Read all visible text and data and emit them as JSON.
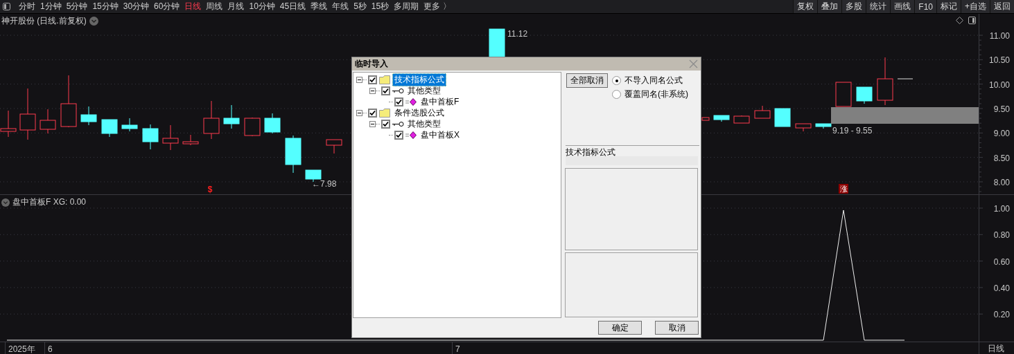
{
  "toolbar": {
    "periods": [
      {
        "label": "分时",
        "selected": false
      },
      {
        "label": "1分钟",
        "selected": false
      },
      {
        "label": "5分钟",
        "selected": false
      },
      {
        "label": "15分钟",
        "selected": false
      },
      {
        "label": "30分钟",
        "selected": false
      },
      {
        "label": "60分钟",
        "selected": false
      },
      {
        "label": "日线",
        "selected": true
      },
      {
        "label": "周线",
        "selected": false
      },
      {
        "label": "月线",
        "selected": false
      },
      {
        "label": "10分钟",
        "selected": false
      },
      {
        "label": "45日线",
        "selected": false
      },
      {
        "label": "季线",
        "selected": false
      },
      {
        "label": "年线",
        "selected": false
      },
      {
        "label": "5秒",
        "selected": false
      },
      {
        "label": "15秒",
        "selected": false
      },
      {
        "label": "多周期",
        "selected": false
      }
    ],
    "more": "更多 〉",
    "actions": [
      "复权",
      "叠加",
      "多股",
      "统计",
      "画线",
      "F10",
      "标记",
      "+自选",
      "返回"
    ]
  },
  "price_chart": {
    "title": "神开股份 (日线.前复权)",
    "axis_labels": [
      "11.00",
      "10.50",
      "10.00",
      "9.50",
      "9.00",
      "8.50",
      "8.00"
    ],
    "high_label": "11.12",
    "low_label": "←7.98",
    "range_label": "9.19 - 9.55",
    "markers": [
      {
        "text": "$",
        "kind": "signal"
      },
      {
        "text": "涨",
        "kind": "badge"
      }
    ]
  },
  "indicator": {
    "title": "盘中首板F  XG: 0.00",
    "axis_labels": [
      "1.00",
      "0.80",
      "0.60",
      "0.40",
      "0.20"
    ]
  },
  "time_axis": {
    "labels": [
      "2025年",
      "6",
      "7"
    ],
    "period": "日线"
  },
  "dialog": {
    "title": "临时导入",
    "tree": [
      {
        "label": "技术指标公式",
        "kind": "folder",
        "checked": true,
        "expanded": true,
        "selected": true,
        "children": [
          {
            "label": "其他类型",
            "kind": "type",
            "checked": true,
            "expanded": true,
            "selected": false,
            "children": [
              {
                "label": "盘中首板F",
                "kind": "formula",
                "checked": true,
                "selected": false
              }
            ]
          }
        ]
      },
      {
        "label": "条件选股公式",
        "kind": "folder",
        "checked": true,
        "expanded": true,
        "selected": false,
        "children": [
          {
            "label": "其他类型",
            "kind": "type",
            "checked": true,
            "expanded": true,
            "selected": false,
            "children": [
              {
                "label": "盘中首板X",
                "kind": "formula",
                "checked": true,
                "selected": false
              }
            ]
          }
        ]
      }
    ],
    "cancel_all_button": "全部取消",
    "options": [
      {
        "label": "不导入同名公式",
        "selected": true
      },
      {
        "label": "覆盖同名(非系统)",
        "selected": false
      }
    ],
    "category_label": "技术指标公式",
    "ok_button": "确定",
    "cancel_button": "取消"
  }
}
